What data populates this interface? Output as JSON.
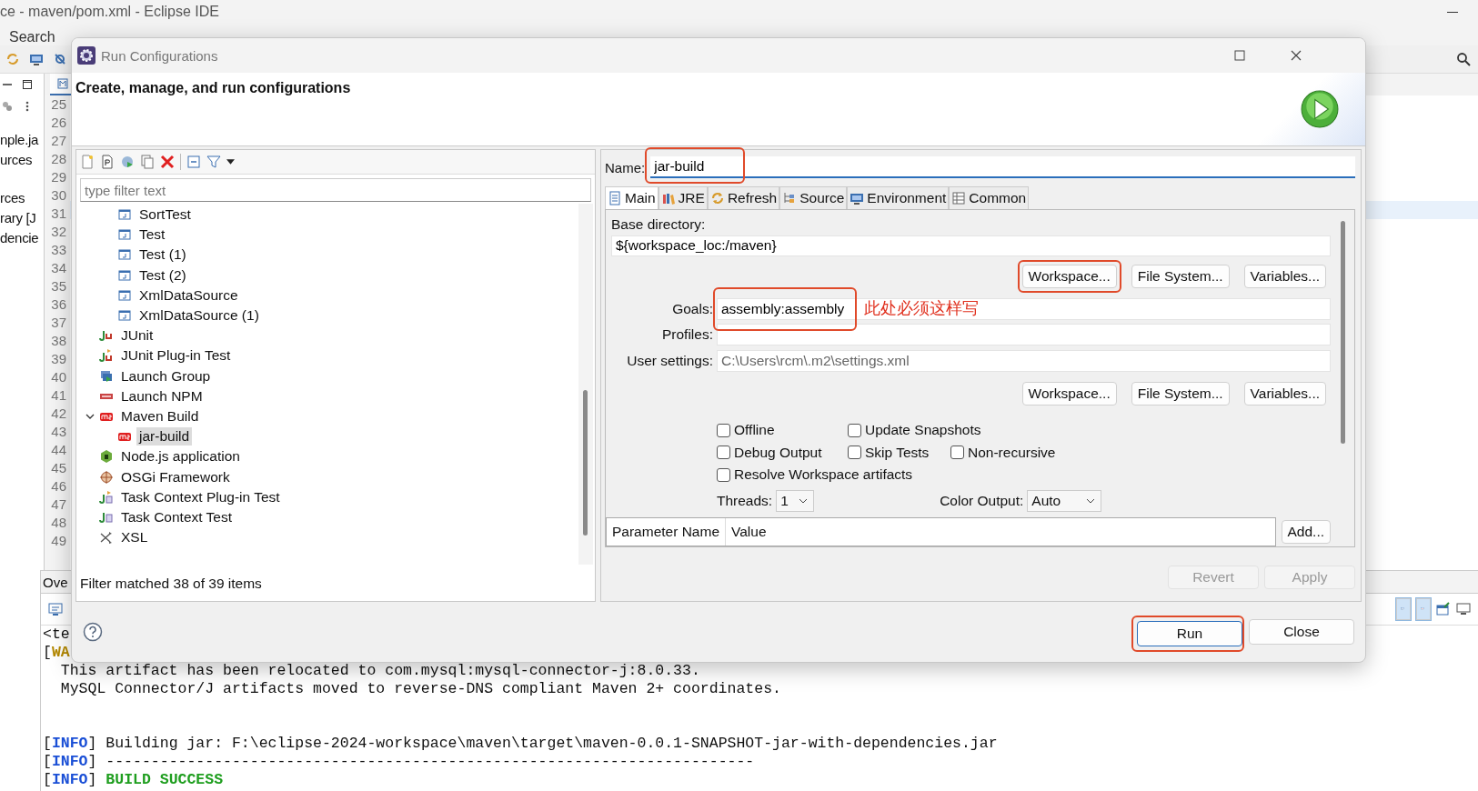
{
  "background": {
    "window_title": "ce - maven/pom.xml - Eclipse IDE",
    "menu": [
      "Search"
    ],
    "explorer_fragments": [
      [
        "nple.ja",
        "urces"
      ],
      [
        "rces",
        "rary [J",
        "dencie"
      ]
    ],
    "line_numbers": [
      "25",
      "26",
      "27",
      "28",
      "29",
      "30",
      "31",
      "32",
      "33",
      "34",
      "35",
      "36",
      "37",
      "38",
      "39",
      "40",
      "41",
      "42",
      "43",
      "44",
      "45",
      "46",
      "47",
      "48",
      "49"
    ],
    "bottom_tab": "Ove",
    "console_header": "<te",
    "console_lines": [
      {
        "kind": "warning",
        "text": "[**WA**"
      },
      {
        "kind": "text",
        "text": "  This artifact has been relocated to com.mysql:mysql-connector-j:8.0.33."
      },
      {
        "kind": "text",
        "text": "  MySQL Connector/J artifacts moved to reverse-DNS compliant Maven 2+ coordinates."
      },
      {
        "kind": "blank"
      },
      {
        "kind": "blank"
      },
      {
        "kind": "info",
        "text": "[**INFO**] Building jar: F:\\eclipse-2024-workspace\\maven\\target\\maven-0.0.1-SNAPSHOT-jar-with-dependencies.jar"
      },
      {
        "kind": "info",
        "text": "[**INFO**] ------------------------------------------------------------------------"
      },
      {
        "kind": "success",
        "text": "[**INFO**] **BUILD SUCCESS**"
      }
    ]
  },
  "dialog": {
    "title": "Run Configurations",
    "header": "Create, manage, and run configurations",
    "filter": {
      "placeholder": "type filter text"
    },
    "tree": {
      "scrolled_group_children": [
        {
          "label": "SortTest",
          "kind": "java",
          "selected": false
        },
        {
          "label": "Test",
          "kind": "java",
          "selected": false
        },
        {
          "label": "Test (1)",
          "kind": "java",
          "selected": false
        },
        {
          "label": "Test (2)",
          "kind": "java",
          "selected": false
        },
        {
          "label": "XmlDataSource",
          "kind": "java",
          "selected": false
        },
        {
          "label": "XmlDataSource (1)",
          "kind": "java",
          "selected": false
        }
      ],
      "items": [
        {
          "label": "JUnit",
          "kind": "junit",
          "selected": false
        },
        {
          "label": "JUnit Plug-in Test",
          "kind": "junit-plugin",
          "selected": false
        },
        {
          "label": "Launch Group",
          "kind": "launch-group",
          "selected": false
        },
        {
          "label": "Launch NPM",
          "kind": "npm",
          "selected": false
        },
        {
          "label": "Maven Build",
          "kind": "m2",
          "selected": false,
          "expanded": true,
          "children": [
            {
              "label": "jar-build",
              "kind": "m2",
              "selected": true
            }
          ]
        },
        {
          "label": "Node.js application",
          "kind": "node",
          "selected": false
        },
        {
          "label": "OSGi Framework",
          "kind": "osgi",
          "selected": false
        },
        {
          "label": "Task Context Plug-in Test",
          "kind": "task-plugin",
          "selected": false
        },
        {
          "label": "Task Context Test",
          "kind": "task",
          "selected": false
        },
        {
          "label": "XSL",
          "kind": "xsl",
          "selected": false
        }
      ]
    },
    "filter_status": "Filter matched 38 of 39 items",
    "name": {
      "label": "Name:",
      "value": "jar-build",
      "highlighted": true
    },
    "tabs": [
      {
        "label": "Main",
        "kind": "main",
        "selected": true
      },
      {
        "label": "JRE",
        "kind": "jre",
        "selected": false
      },
      {
        "label": "Refresh",
        "kind": "refresh",
        "selected": false
      },
      {
        "label": "Source",
        "kind": "source",
        "selected": false
      },
      {
        "label": "Environment",
        "kind": "environment",
        "selected": false
      },
      {
        "label": "Common",
        "kind": "common",
        "selected": false
      }
    ],
    "base_directory": {
      "label": "Base directory:",
      "value": "${workspace_loc:/maven}"
    },
    "base_buttons": [
      {
        "label": "Workspace...",
        "highlighted": true
      },
      {
        "label": "File System...",
        "highlighted": false
      },
      {
        "label": "Variables...",
        "highlighted": false
      }
    ],
    "goals": {
      "label": "Goals:",
      "value": "assembly:assembly",
      "highlighted": true
    },
    "annotation": "此处必须这样写",
    "profiles": {
      "label": "Profiles:"
    },
    "user_settings": {
      "label": "User settings:",
      "value": "C:\\Users\\rcm\\.m2\\settings.xml"
    },
    "settings_buttons": [
      "Workspace...",
      "File System...",
      "Variables..."
    ],
    "options": [
      [
        {
          "label": "Offline",
          "checked": false
        },
        {
          "label": "Update Snapshots",
          "checked": false
        }
      ],
      [
        {
          "label": "Debug Output",
          "checked": false
        },
        {
          "label": "Skip Tests",
          "checked": false
        },
        {
          "label": "Non-recursive",
          "checked": false
        }
      ],
      [
        {
          "label": "Resolve Workspace artifacts",
          "checked": false
        }
      ]
    ],
    "threads": {
      "label": "Threads:",
      "value": "1"
    },
    "color_output": {
      "label": "Color Output:",
      "value": "Auto"
    },
    "parameters": {
      "columns": [
        "Parameter Name",
        "Value"
      ],
      "add": "Add..."
    },
    "revert": {
      "label": "Revert",
      "disabled": true
    },
    "apply": {
      "label": "Apply",
      "disabled": true
    },
    "run": {
      "label": "Run",
      "highlighted": true
    },
    "close": {
      "label": "Close"
    }
  }
}
